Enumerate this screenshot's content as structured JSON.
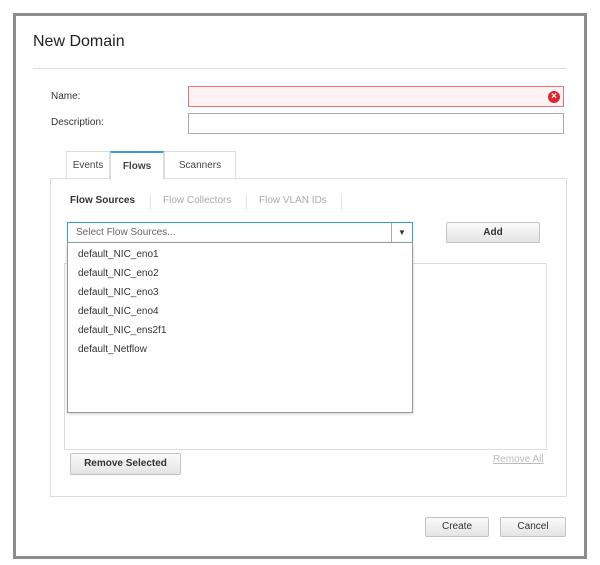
{
  "dialog": {
    "title": "New Domain",
    "name_label": "Name:",
    "name_value": "",
    "description_label": "Description:",
    "description_value": ""
  },
  "tabs": [
    {
      "label": "Events",
      "active": false
    },
    {
      "label": "Flows",
      "active": true
    },
    {
      "label": "Scanners",
      "active": false
    }
  ],
  "subtabs": [
    {
      "label": "Flow Sources",
      "active": true
    },
    {
      "label": "Flow Collectors",
      "active": false
    },
    {
      "label": "Flow VLAN IDs",
      "active": false
    }
  ],
  "select": {
    "placeholder": "Select Flow Sources...",
    "options": [
      "default_NIC_eno1",
      "default_NIC_eno2",
      "default_NIC_eno3",
      "default_NIC_eno4",
      "default_NIC_ens2f1",
      "default_Netflow"
    ]
  },
  "buttons": {
    "add": "Add",
    "remove_selected": "Remove Selected",
    "remove_all": "Remove All",
    "create": "Create",
    "cancel": "Cancel"
  },
  "colors": {
    "accent": "#3a9ad9",
    "error": "#d9282f"
  }
}
